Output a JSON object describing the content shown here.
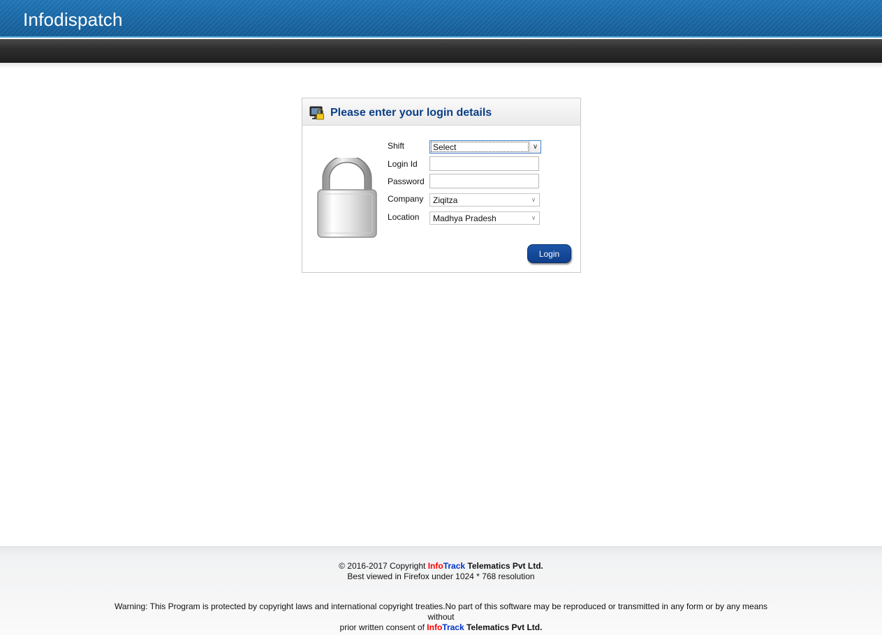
{
  "header": {
    "title": "Infodispatch"
  },
  "login": {
    "heading": "Please enter your login details",
    "fields": {
      "shift_label": "Shift",
      "shift_value": "Select",
      "login_id_label": "Login Id",
      "login_id_value": "",
      "password_label": "Password",
      "password_value": "",
      "company_label": "Company",
      "company_value": "Ziqitza",
      "location_label": "Location",
      "location_value": "Madhya Pradesh"
    },
    "button_label": "Login"
  },
  "footer": {
    "copyright_prefix": "© 2016-2017 Copyright ",
    "brand_info": "Info",
    "brand_track": "Track",
    "company_suffix": " Telematics Pvt Ltd.",
    "best_viewed": "Best viewed in Firefox under 1024 * 768 resolution",
    "warning_line1": "Warning: This Program is protected by copyright laws and international copyright treaties.No part of this software may be reproduced or transmitted in any form or by any means",
    "warning_line2": "without",
    "warning_line3_prefix": "prior written consent of "
  },
  "colors": {
    "header_blue": "#1a68a6",
    "title_blue": "#0b3e86",
    "button_blue": "#0e3f8c",
    "brand_red": "#ff0000",
    "brand_blue": "#0033cc"
  },
  "icons": [
    "monitor-lock-icon",
    "padlock-icon",
    "chevron-down-icon"
  ]
}
